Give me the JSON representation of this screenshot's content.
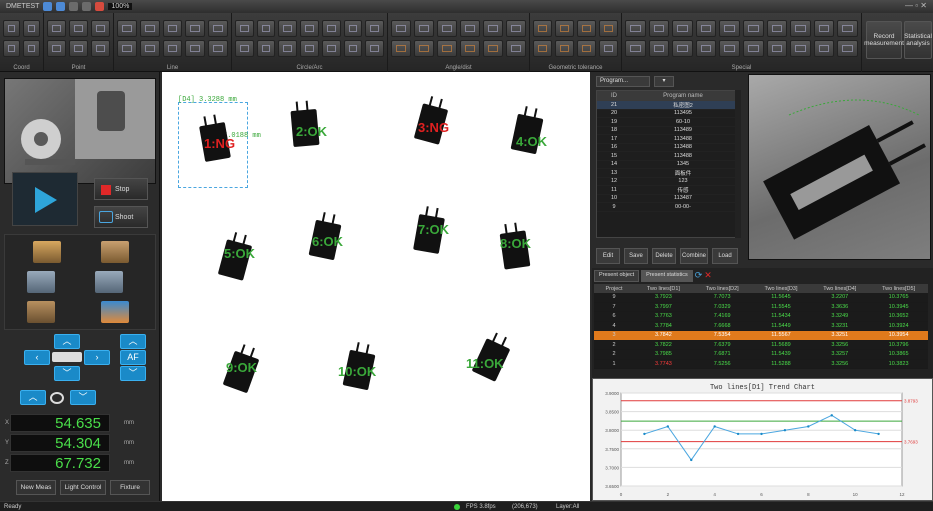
{
  "app": {
    "title": "DMETEST",
    "zoom": "100%"
  },
  "ribbon": {
    "groups": [
      "Coord",
      "Point",
      "Line",
      "Circle/Arc",
      "Angle/dist",
      "Geometric tolerance",
      "Special"
    ],
    "record_label": "Record measurement",
    "stat_label": "Statistical analysis"
  },
  "left": {
    "stop_label": "Stop",
    "shoot_label": "Shoot",
    "af_label": "AF",
    "coords": [
      {
        "axis": "X",
        "value": "54.635",
        "unit": "mm"
      },
      {
        "axis": "Y",
        "value": "54.304",
        "unit": "mm"
      },
      {
        "axis": "Z",
        "value": "67.732",
        "unit": "mm"
      }
    ],
    "btn_new": "New Meas",
    "btn_light": "Light Control",
    "btn_fixture": "Fixture"
  },
  "canvas": {
    "dim1": "[D4] 3.3288 mm",
    "dim2": "[D4] 7.0188 mm",
    "parts": [
      {
        "label": "1:NG",
        "ng": true
      },
      {
        "label": "2:OK",
        "ng": false
      },
      {
        "label": "3:NG",
        "ng": true
      },
      {
        "label": "4:OK",
        "ng": false
      },
      {
        "label": "5:OK",
        "ng": false
      },
      {
        "label": "6:OK",
        "ng": false
      },
      {
        "label": "7:OK",
        "ng": false
      },
      {
        "label": "8:OK",
        "ng": false
      },
      {
        "label": "9:OK",
        "ng": false
      },
      {
        "label": "10:OK",
        "ng": false
      },
      {
        "label": "11:OK",
        "ng": false
      }
    ]
  },
  "program": {
    "dropdown": "Program...",
    "headers": [
      "ID",
      "Program name"
    ],
    "rows": [
      [
        "21",
        "私密图2"
      ],
      [
        "20",
        "113495"
      ],
      [
        "19",
        "60-10"
      ],
      [
        "18",
        "113489"
      ],
      [
        "17",
        "113488"
      ],
      [
        "16",
        "113488"
      ],
      [
        "15",
        "113488"
      ],
      [
        "14",
        "1345"
      ],
      [
        "13",
        "面板件"
      ],
      [
        "12",
        "123"
      ],
      [
        "11",
        "传感"
      ],
      [
        "10",
        "113487"
      ],
      [
        "9",
        "00-00-"
      ]
    ],
    "buttons": [
      "Edit",
      "Save",
      "Delete",
      "Combine",
      "Load"
    ]
  },
  "measure": {
    "tabs": [
      "Present object",
      "Present statistics"
    ],
    "headers": [
      "Project",
      "Two lines[D1]",
      "Two lines[D2]",
      "Two lines[D3]",
      "Two lines[D4]",
      "Two lines[D5]"
    ],
    "rows": [
      [
        "9",
        "3.7923",
        "7.7073",
        "11.5645",
        "3.2207",
        "10.3765"
      ],
      [
        "7",
        "3.7997",
        "7.0329",
        "11.5545",
        "3.3636",
        "10.3945"
      ],
      [
        "6",
        "3.7763",
        "7.4169",
        "11.5434",
        "3.3249",
        "10.3652"
      ],
      [
        "4",
        "3.7784",
        "7.6668",
        "11.5449",
        "3.3231",
        "10.3924"
      ],
      [
        "3",
        "3.7842",
        "7.5354",
        "11.5567",
        "3.3251",
        "10.3954"
      ],
      [
        "2",
        "3.7822",
        "7.6379",
        "11.5689",
        "3.3256",
        "10.3796"
      ],
      [
        "2",
        "3.7985",
        "7.6871",
        "11.5439",
        "3.3257",
        "10.3865"
      ],
      [
        "1",
        "3.7743",
        "7.5256",
        "11.5288",
        "3.3256",
        "10.3823"
      ]
    ],
    "highlight_index": 4,
    "ng_index": 7
  },
  "trend": {
    "title": "Two lines[D1] Trend Chart",
    "ylabels": [
      "3.9000",
      "3.8500",
      "3.8000",
      "3.7500",
      "3.7000",
      "3.6500"
    ],
    "xlabels": [
      "0",
      "2",
      "4",
      "6",
      "8",
      "10",
      "12"
    ],
    "upper_label": "3.8793",
    "lower_label": "3.7693",
    "values": [
      3.79,
      3.81,
      3.72,
      3.81,
      3.79,
      3.79,
      3.8,
      3.81,
      3.84,
      3.8,
      3.79
    ]
  },
  "colors": {
    "accent": "#1a8ac8",
    "ok": "#3aa83a",
    "ng": "#e02020",
    "highlight": "#e07a1c"
  },
  "status": {
    "ready": "Ready",
    "fps": "FPS 3.8fps",
    "pos": "(206,673)",
    "layer": "Layer:All"
  }
}
